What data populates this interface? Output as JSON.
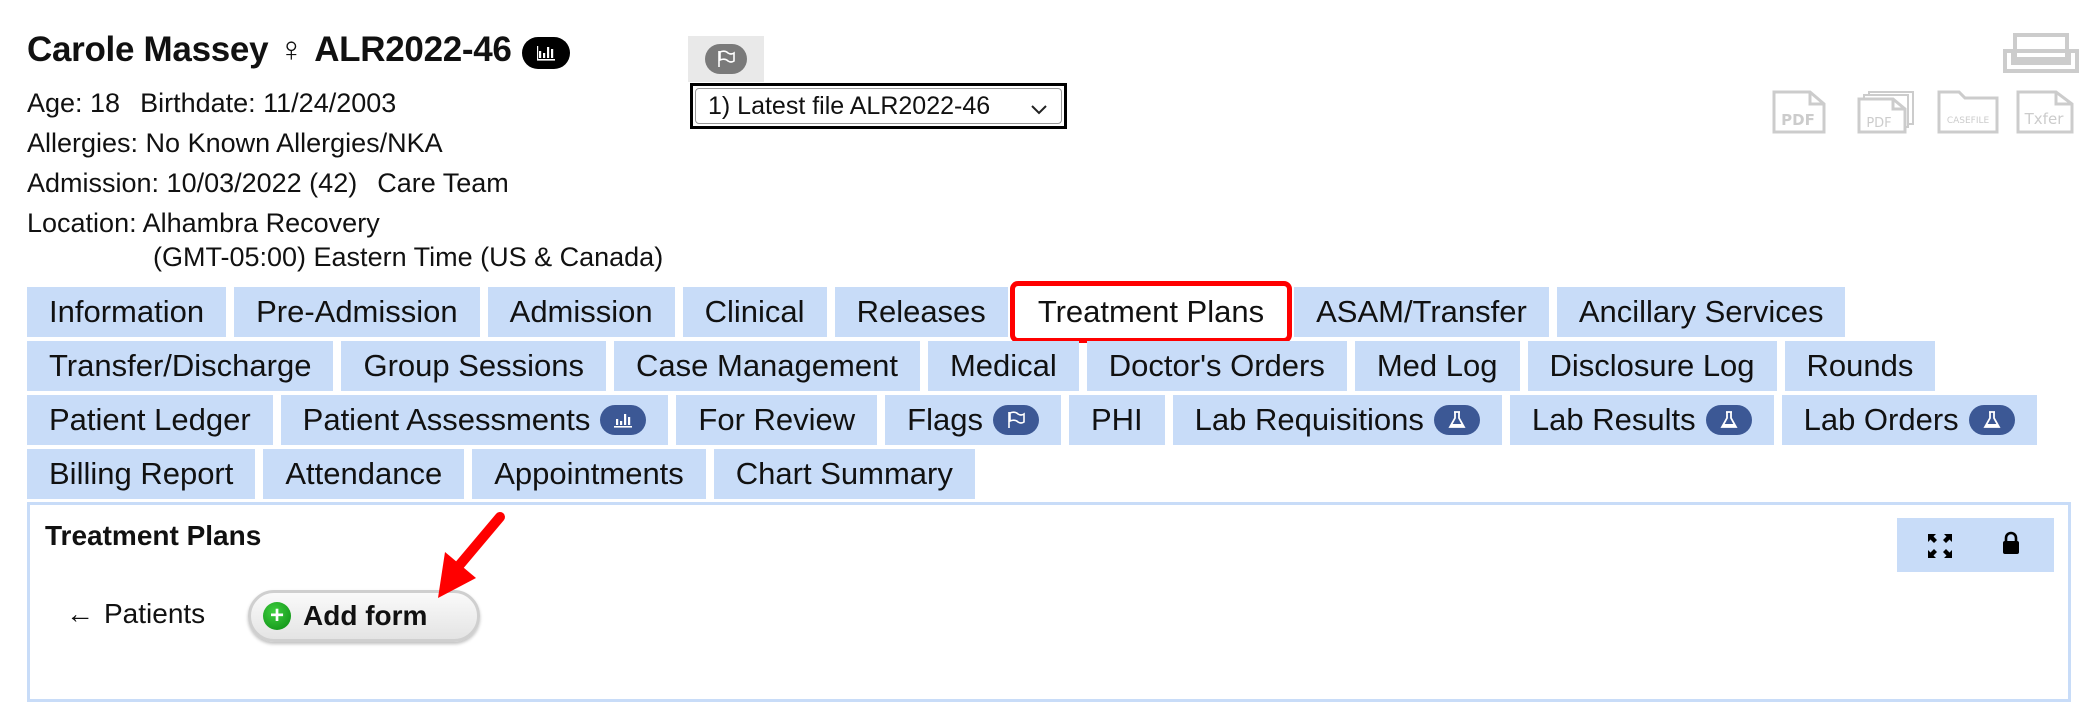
{
  "patient": {
    "name": "Carole Massey",
    "gender_symbol": "♀",
    "record_id": "ALR2022-46",
    "age_label": "Age: 18",
    "birthdate_label": "Birthdate: 11/24/2003",
    "allergies_label": "Allergies: No Known Allergies/NKA",
    "admission_label": "Admission: 10/03/2022 (42)",
    "care_team_label": "Care Team",
    "location_label": "Location: Alhambra Recovery",
    "timezone_label": "(GMT-05:00) Eastern Time (US & Canada)"
  },
  "file_select": {
    "selected": "1) Latest file ALR2022-46"
  },
  "toolbar_icons": {
    "print": "print-icon",
    "pdf": "PDF",
    "pdf_multi": "PDF",
    "casefile": "CASEFILE",
    "transfer": "Txfer"
  },
  "tabs": {
    "rows": [
      [
        {
          "label": "Information"
        },
        {
          "label": "Pre-Admission"
        },
        {
          "label": "Admission"
        },
        {
          "label": "Clinical"
        },
        {
          "label": "Releases"
        },
        {
          "label": "Treatment Plans",
          "active": true
        },
        {
          "label": "ASAM/Transfer"
        },
        {
          "label": "Ancillary Services"
        }
      ],
      [
        {
          "label": "Transfer/Discharge"
        },
        {
          "label": "Group Sessions"
        },
        {
          "label": "Case Management"
        },
        {
          "label": "Medical"
        },
        {
          "label": "Doctor's Orders"
        },
        {
          "label": "Med Log"
        },
        {
          "label": "Disclosure Log"
        },
        {
          "label": "Rounds"
        }
      ],
      [
        {
          "label": "Patient Ledger"
        },
        {
          "label": "Patient Assessments",
          "badge": "chart"
        },
        {
          "label": "For Review"
        },
        {
          "label": "Flags",
          "badge": "flag"
        },
        {
          "label": "PHI"
        },
        {
          "label": "Lab Requisitions",
          "badge": "flask"
        },
        {
          "label": "Lab Results",
          "badge": "flask"
        },
        {
          "label": "Lab Orders",
          "badge": "flask"
        }
      ],
      [
        {
          "label": "Billing Report"
        },
        {
          "label": "Attendance"
        },
        {
          "label": "Appointments"
        },
        {
          "label": "Chart Summary"
        }
      ]
    ]
  },
  "panel": {
    "title": "Treatment Plans",
    "back_label": "Patients",
    "back_arrow": "←",
    "add_form_label": "Add form",
    "add_icon": "+"
  },
  "colors": {
    "tab_bg": "#c8dcf8",
    "active_outline": "#ff0000",
    "badge_bg": "#3c5895",
    "annotation_arrow": "#ff0000"
  }
}
